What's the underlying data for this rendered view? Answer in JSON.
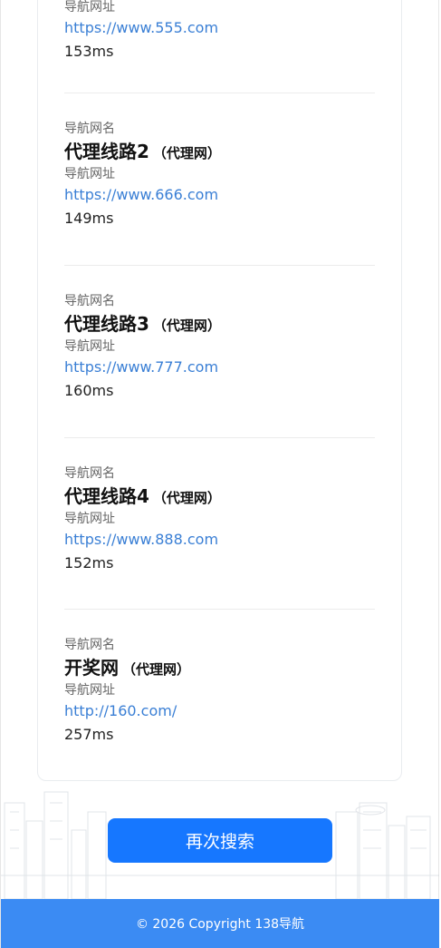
{
  "entries": [
    {
      "name_label": "",
      "name": "",
      "tag": "",
      "url_label": "导航网址",
      "url": "https://www.555.com",
      "latency": "153ms"
    },
    {
      "name_label": "导航网名",
      "name": "代理线路2",
      "tag": "（代理网）",
      "url_label": "导航网址",
      "url": "https://www.666.com",
      "latency": "149ms"
    },
    {
      "name_label": "导航网名",
      "name": "代理线路3",
      "tag": "（代理网）",
      "url_label": "导航网址",
      "url": "https://www.777.com",
      "latency": "160ms"
    },
    {
      "name_label": "导航网名",
      "name": "代理线路4",
      "tag": "（代理网）",
      "url_label": "导航网址",
      "url": "https://www.888.com",
      "latency": "152ms"
    },
    {
      "name_label": "导航网名",
      "name": "开奖网",
      "tag": "（代理网）",
      "url_label": "导航网址",
      "url": "http://160.com/",
      "latency": "257ms"
    }
  ],
  "search_again_button": "再次搜索",
  "footer": {
    "copyright": "© 2026 Copyright 138导航"
  },
  "colors": {
    "primary": "#1677ff",
    "footer": "#3b8bf3",
    "link": "#3a7fd5"
  }
}
